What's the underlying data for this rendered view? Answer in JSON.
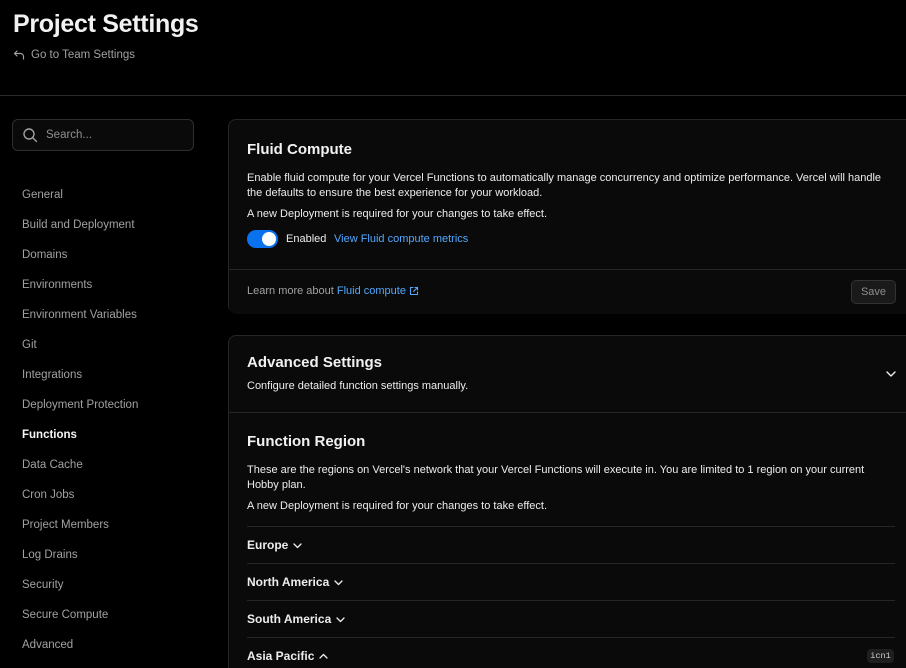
{
  "header": {
    "title": "Project Settings",
    "back_link": "Go to Team Settings"
  },
  "sidebar": {
    "search_placeholder": "Search...",
    "items": [
      {
        "label": "General"
      },
      {
        "label": "Build and Deployment"
      },
      {
        "label": "Domains"
      },
      {
        "label": "Environments"
      },
      {
        "label": "Environment Variables"
      },
      {
        "label": "Git"
      },
      {
        "label": "Integrations"
      },
      {
        "label": "Deployment Protection"
      },
      {
        "label": "Functions",
        "active": true
      },
      {
        "label": "Data Cache"
      },
      {
        "label": "Cron Jobs"
      },
      {
        "label": "Project Members"
      },
      {
        "label": "Log Drains"
      },
      {
        "label": "Security"
      },
      {
        "label": "Secure Compute"
      },
      {
        "label": "Advanced"
      }
    ]
  },
  "fluid_compute": {
    "title": "Fluid Compute",
    "description": "Enable fluid compute for your Vercel Functions to automatically manage concurrency and optimize performance. Vercel will handle the defaults to ensure the best experience for your workload.",
    "notice": "A new Deployment is required for your changes to take effect.",
    "toggle_on": true,
    "toggle_label": "Enabled",
    "metrics_link": "View Fluid compute metrics",
    "learn_more_prefix": "Learn more about",
    "learn_more_link": "Fluid compute",
    "save_label": "Save"
  },
  "advanced": {
    "title": "Advanced Settings",
    "subtitle": "Configure detailed function settings manually."
  },
  "function_region": {
    "title": "Function Region",
    "description": "These are the regions on Vercel's network that your Vercel Functions will execute in. You are limited to 1 region on your current Hobby plan.",
    "notice": "A new Deployment is required for your changes to take effect.",
    "regions": [
      {
        "label": "Europe",
        "expanded": false
      },
      {
        "label": "North America",
        "expanded": false
      },
      {
        "label": "South America",
        "expanded": false
      },
      {
        "label": "Asia Pacific",
        "expanded": true
      }
    ],
    "badge": "icn1"
  },
  "colors": {
    "accent": "#0a72ef",
    "link": "#52a8ff",
    "background": "#000000"
  }
}
